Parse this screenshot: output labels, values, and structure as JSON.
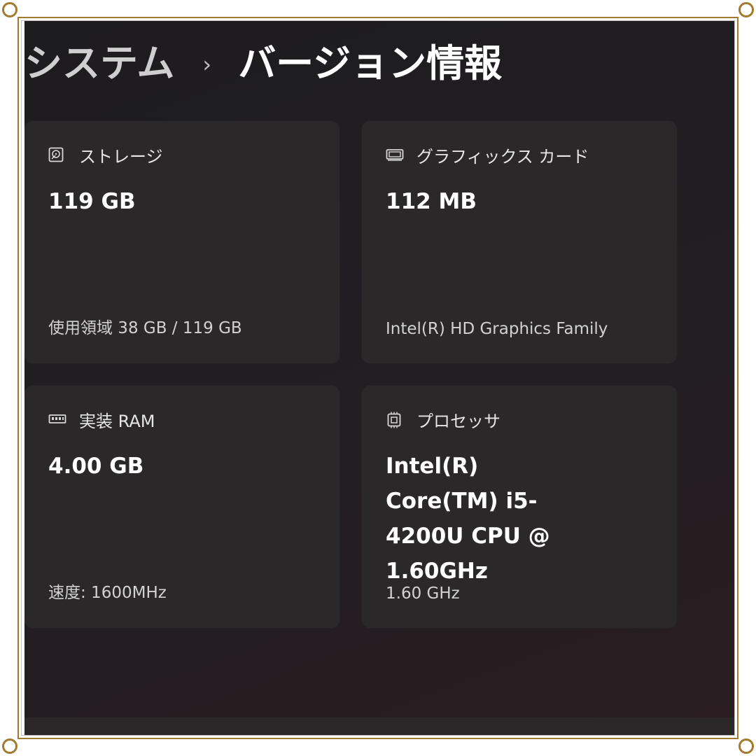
{
  "breadcrumb": {
    "parent": "システム",
    "separator": "›",
    "current": "バージョン情報"
  },
  "cards": {
    "storage": {
      "icon": "hard-drive-icon",
      "label": "ストレージ",
      "value": "119 GB",
      "detail": "使用領域 38 GB / 119 GB"
    },
    "graphics": {
      "icon": "display-adapter-icon",
      "label": "グラフィックス カード",
      "value": "112 MB",
      "detail": "Intel(R) HD Graphics Family"
    },
    "ram": {
      "icon": "memory-module-icon",
      "label": "実装 RAM",
      "value": "4.00 GB",
      "detail": "速度: 1600MHz"
    },
    "processor": {
      "icon": "processor-chip-icon",
      "label": "プロセッサ",
      "value": "Intel(R) Core(TM) i5-4200U CPU @ 1.60GHz",
      "detail": "1.60 GHz"
    }
  },
  "colors": {
    "frame_border": "#a27b2f",
    "background": "#1f1d1f",
    "card_background": "#2a2829",
    "text_primary": "#ffffff",
    "text_secondary": "#d2d2d2"
  }
}
